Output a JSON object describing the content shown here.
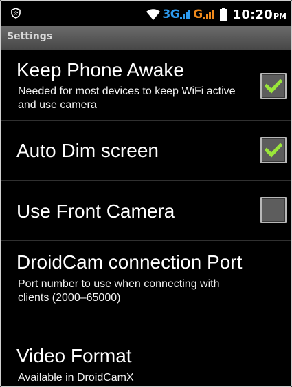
{
  "status_bar": {
    "net_3g": "3G",
    "net_g": "G",
    "time": "10:20",
    "ampm": "PM",
    "colors": {
      "net_blue": "#2d9bf0",
      "net_orange": "#f08a1c"
    }
  },
  "title_bar": {
    "title": "Settings"
  },
  "settings": [
    {
      "title": "Keep Phone Awake",
      "summary": "Needed for most devices to keep WiFi active and use camera",
      "checked": true
    },
    {
      "title": "Auto Dim screen",
      "summary": "",
      "checked": true
    },
    {
      "title": "Use Front Camera",
      "summary": "",
      "checked": false
    },
    {
      "title": "DroidCam connection Port",
      "summary": "Port number to use when connecting with clients (2000–65000)"
    },
    {
      "title": "Video Format",
      "summary": "Available in DroidCamX"
    }
  ],
  "colors": {
    "check_green": "#9ae63a",
    "checkbox_fill": "#5d5d5d"
  }
}
